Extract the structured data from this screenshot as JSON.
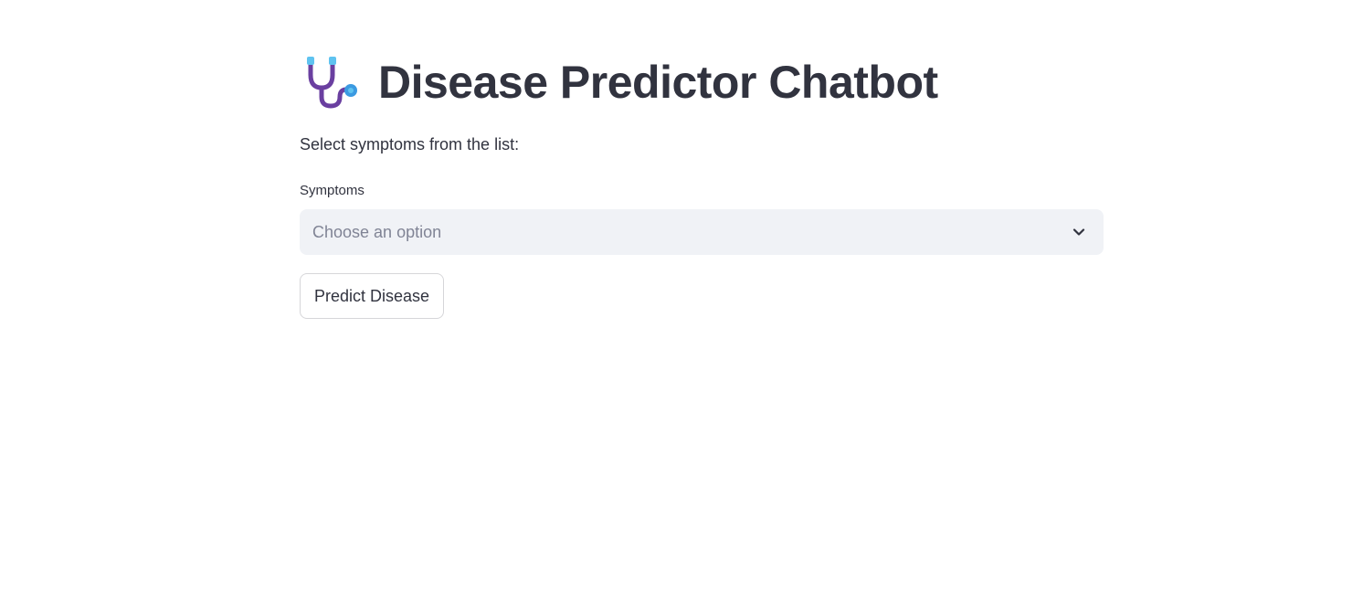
{
  "header": {
    "icon": "stethoscope-icon",
    "title": "Disease Predictor Chatbot"
  },
  "main": {
    "instruction": "Select symptoms from the list:",
    "symptoms_field": {
      "label": "Symptoms",
      "placeholder": "Choose an option",
      "icon": "chevron-down-icon"
    },
    "predict_button_label": "Predict Disease"
  },
  "colors": {
    "text": "#31333f",
    "select_background": "#f0f2f6",
    "placeholder": "#808495",
    "button_border": "#d6d6d9",
    "icon_purple": "#6a3fa0",
    "icon_blue": "#3b9ae1",
    "icon_light_blue": "#5fc3f0"
  }
}
